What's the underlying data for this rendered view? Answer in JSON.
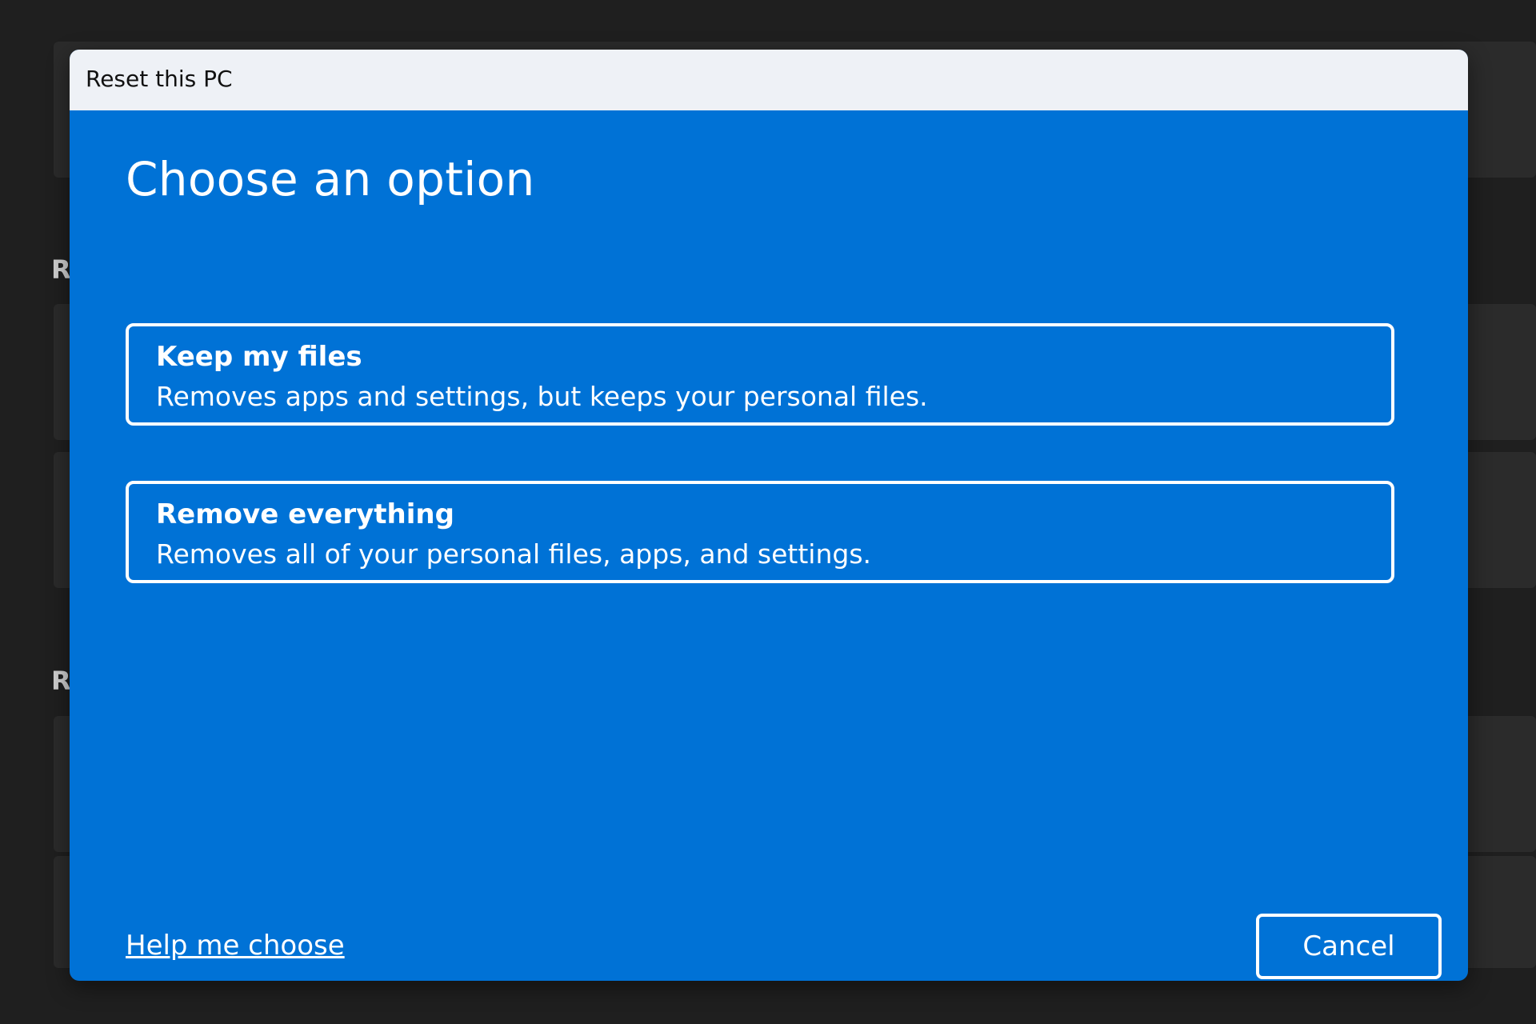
{
  "background": {
    "headings": [
      "R",
      "R"
    ]
  },
  "window": {
    "title": "Reset this PC"
  },
  "dialog": {
    "heading": "Choose an option",
    "options": [
      {
        "title": "Keep my files",
        "description": "Removes apps and settings, but keeps your personal files."
      },
      {
        "title": "Remove everything",
        "description": "Removes all of your personal files, apps, and settings."
      }
    ],
    "help_link": "Help me choose",
    "cancel_label": "Cancel"
  },
  "colors": {
    "dialog_blue": "#0072d6",
    "titlebar_bg": "#eef1f6",
    "page_bg": "#1f1f1f",
    "text_white": "#ffffff"
  }
}
